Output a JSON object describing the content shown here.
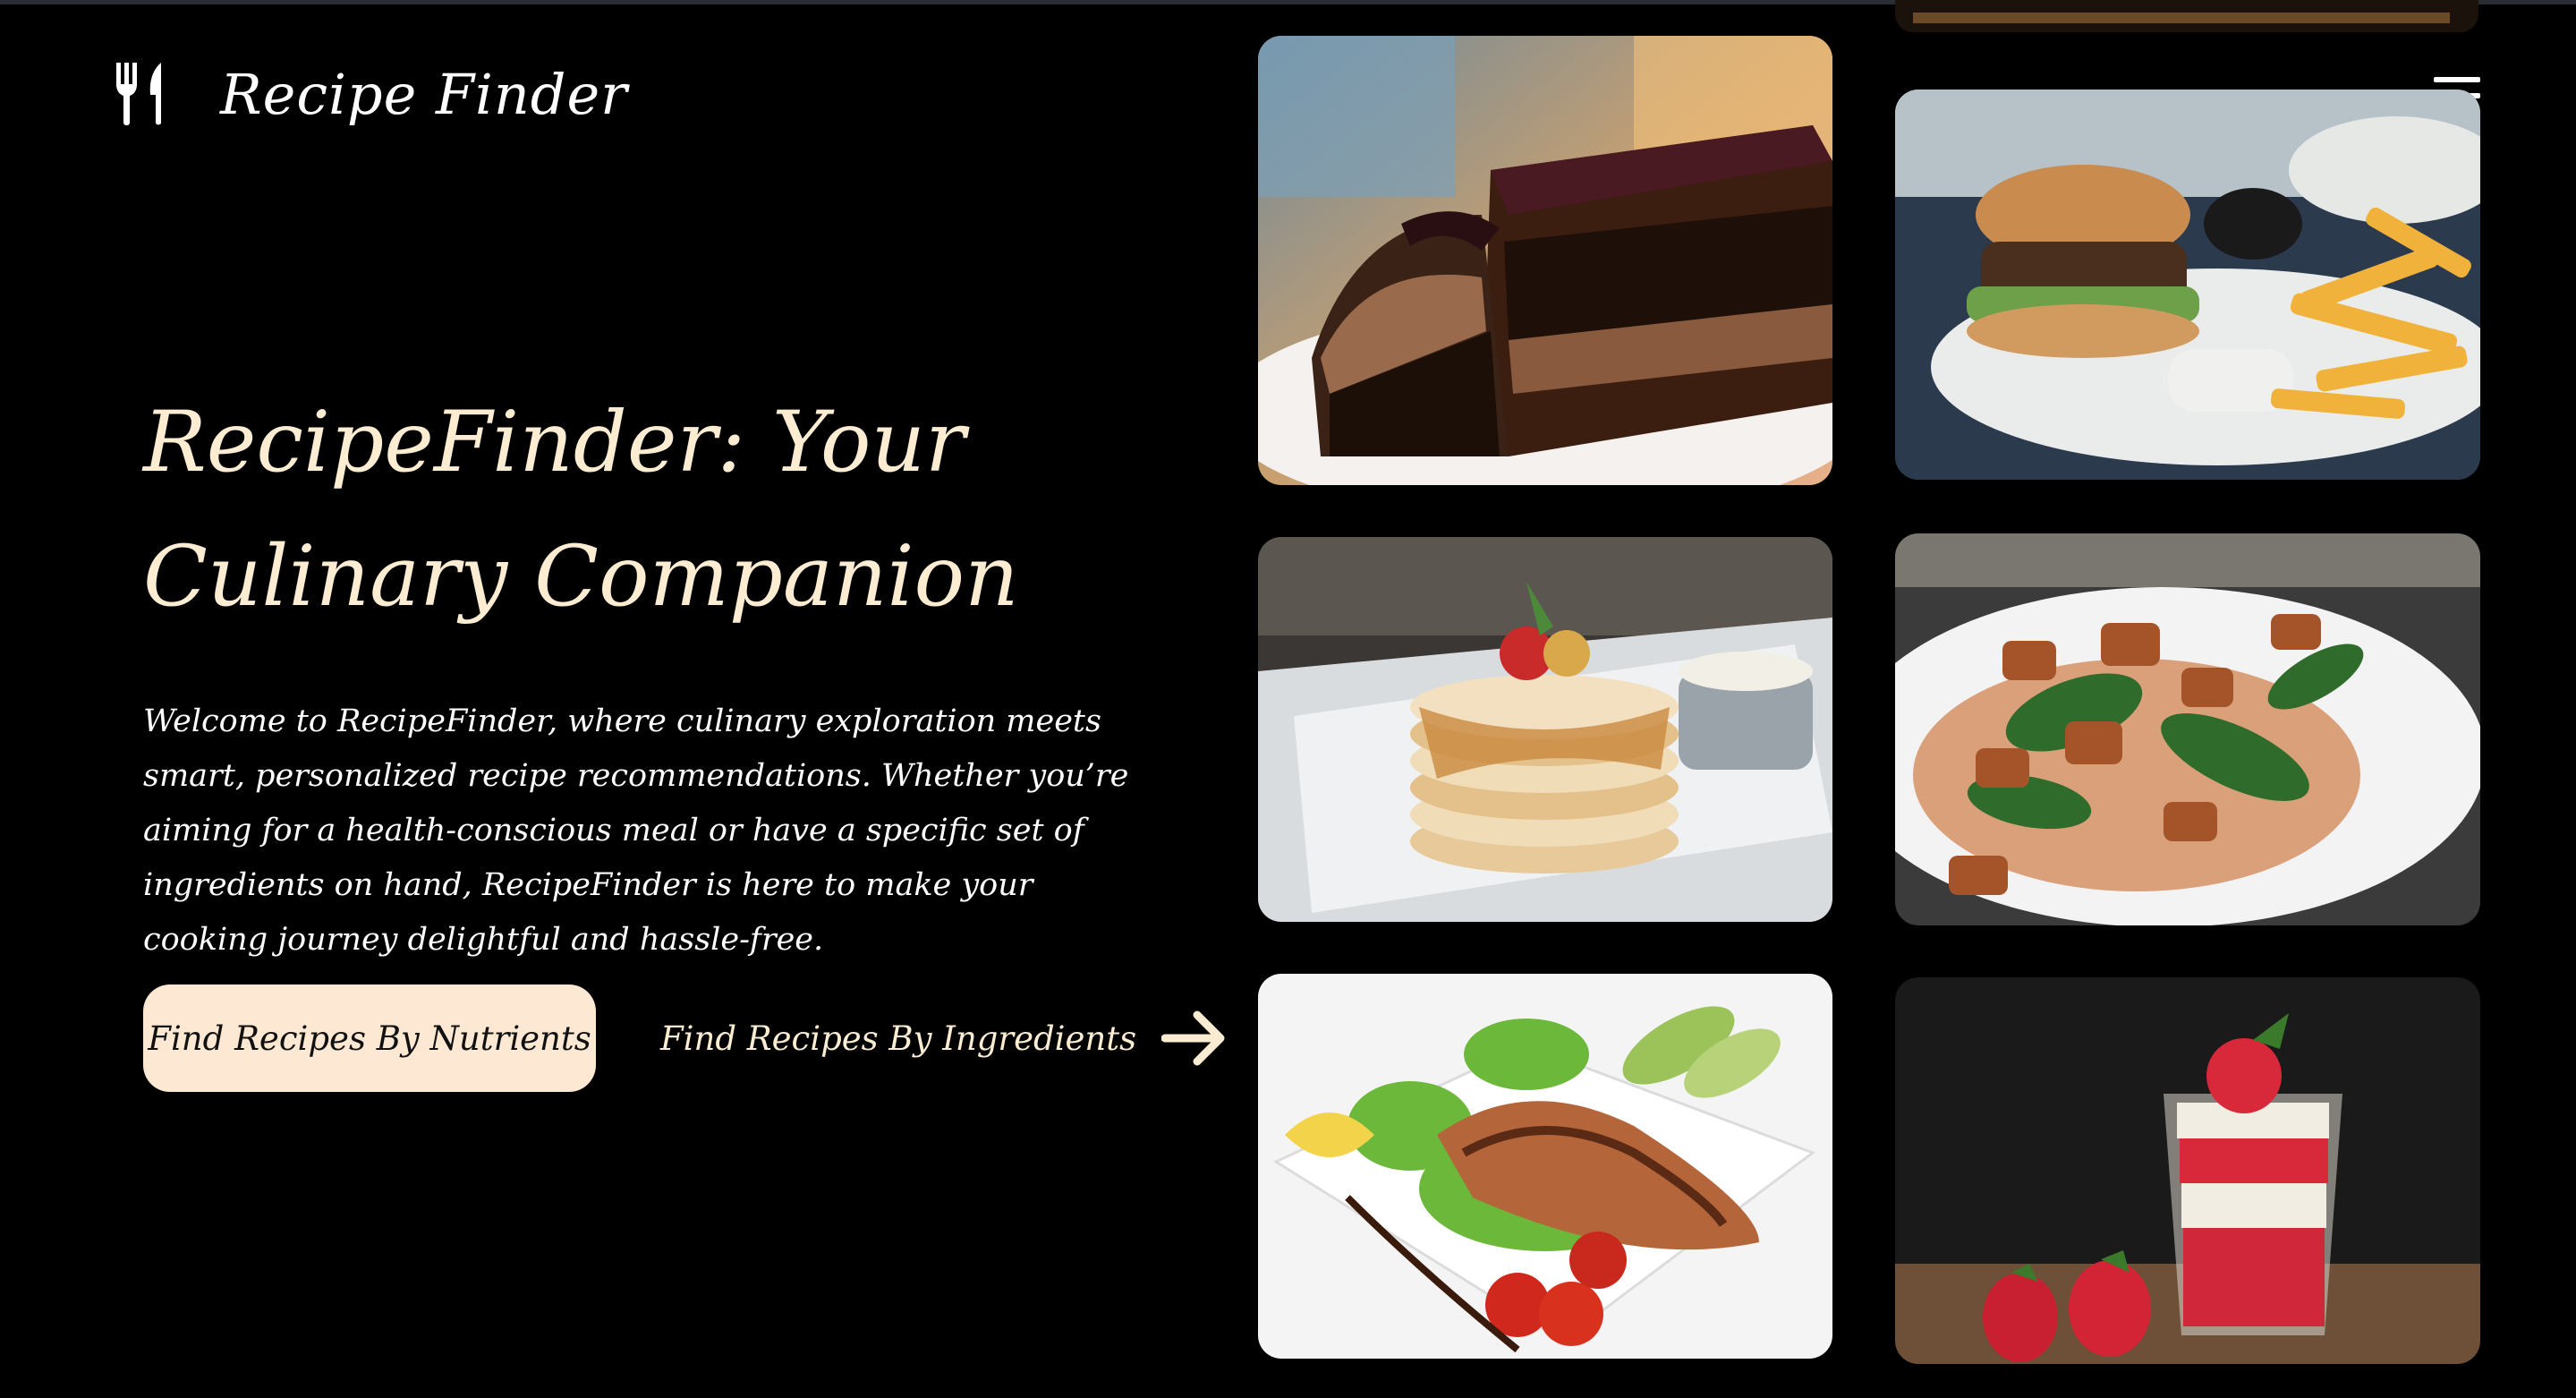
{
  "header": {
    "brand_name": "Recipe Finder",
    "brand_icon": "utensils-icon",
    "menu_icon": "hamburger-menu-icon"
  },
  "hero": {
    "title": "RecipeFinder: Your Culinary Companion",
    "description": "Welcome to RecipeFinder, where culinary exploration meets smart, personalized recipe recommendations. Whether you’re aiming for a health-conscious meal or have a specific set of ingredients on hand, RecipeFinder is here to make your cooking journey delightful and hassle-free.",
    "primary_button": "Find Recipes By Nutrients",
    "secondary_link": "Find Recipes By Ingredients",
    "secondary_icon": "arrow-right-icon"
  },
  "gallery": {
    "images": [
      "chocolate-cake-image",
      "burger-fries-image",
      "pancake-stack-image",
      "chicken-salad-image",
      "grilled-salmon-image",
      "strawberry-parfait-image"
    ]
  },
  "colors": {
    "background": "#000000",
    "accent_cream": "#fde9d3",
    "title_cream": "#fcecd2",
    "text": "#ffffff"
  }
}
